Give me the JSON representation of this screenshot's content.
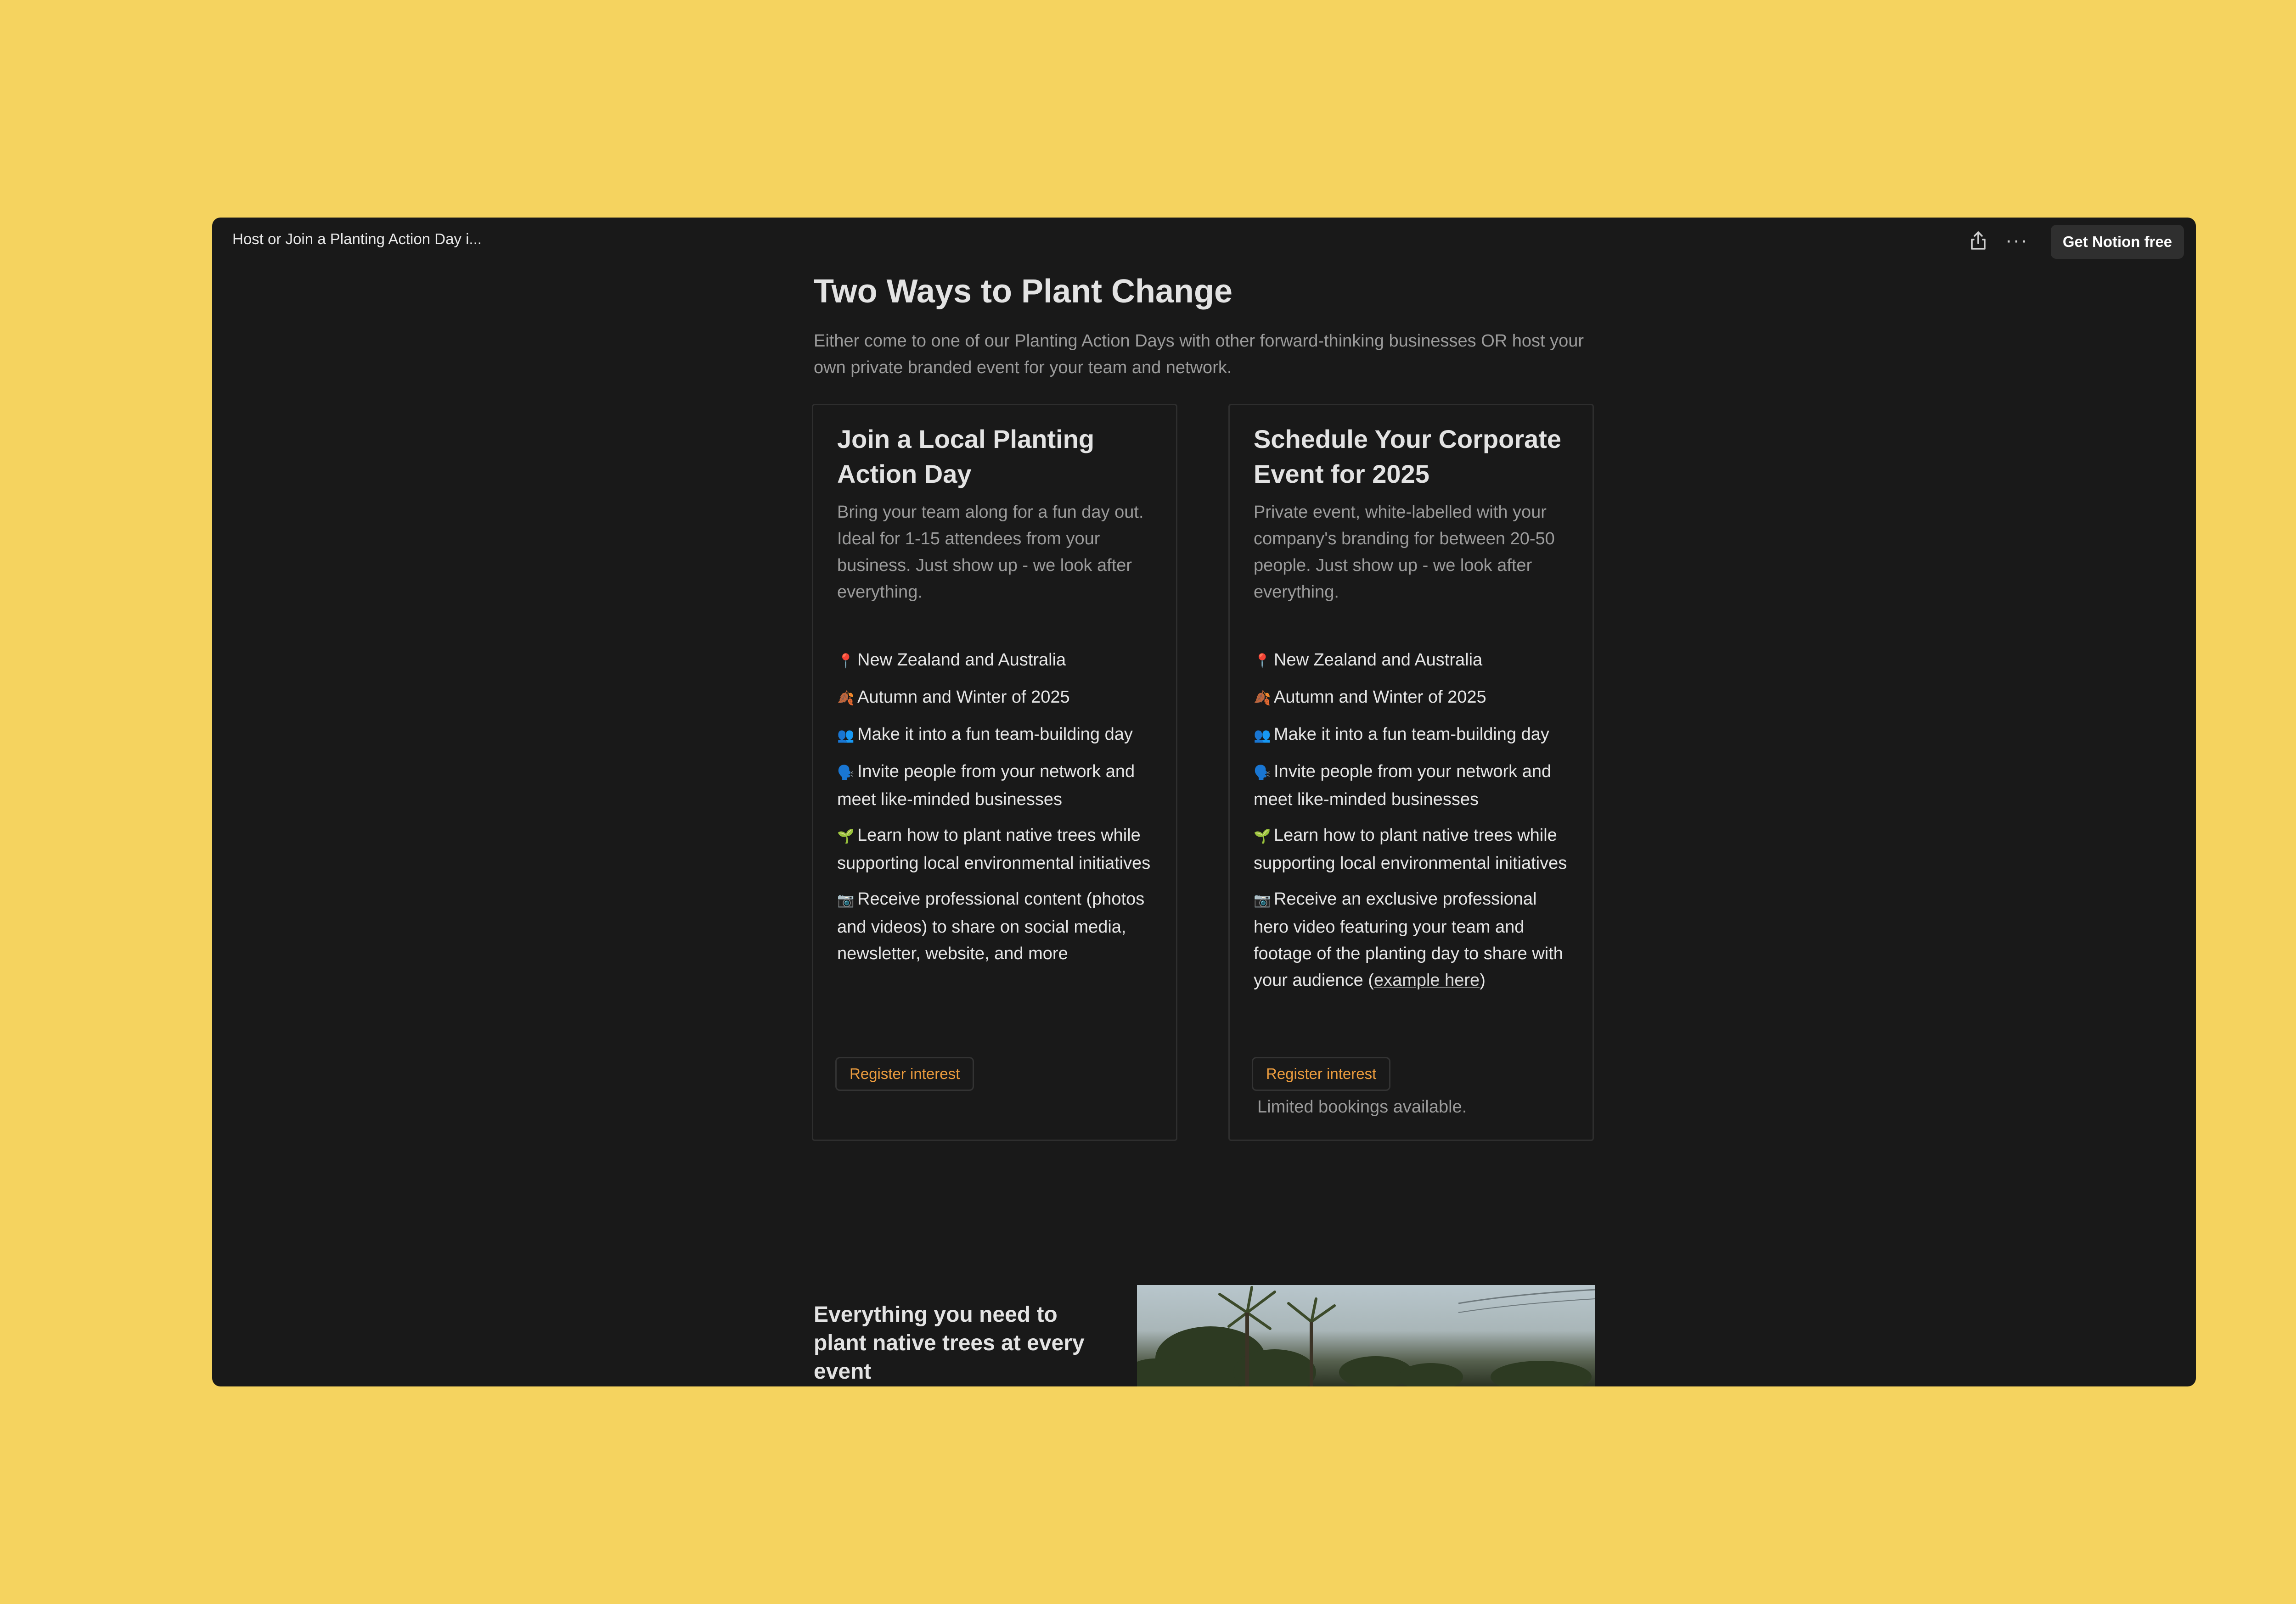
{
  "topbar": {
    "page_tab_title": "Host or Join a Planting Action Day i...",
    "get_notion_label": "Get Notion free",
    "more_label": "···"
  },
  "page": {
    "title": "Two Ways to Plant Change",
    "description": "Either come to one of our Planting Action Days with other forward-thinking businesses OR host your own private branded event for your team and network."
  },
  "cards": [
    {
      "title": "Join a Local Planting Action Day",
      "description": "Bring your team along for a fun day out. Ideal for 1-15 attendees from your business. Just show up - we look after everything.",
      "features": [
        {
          "emoji": "📍",
          "text": "New Zealand and Australia"
        },
        {
          "emoji": "🍂",
          "text": "Autumn and Winter of 2025"
        },
        {
          "emoji": "👥",
          "text": "Make it into a fun team-building day"
        },
        {
          "emoji": "🗣️",
          "text": "Invite people from your network and meet like-minded businesses"
        },
        {
          "emoji": "🌱",
          "text": "Learn how to plant native trees while supporting local environmental initiatives"
        },
        {
          "emoji": "📷",
          "text": "Receive professional content (photos and videos) to share on social media, newsletter, website, and more"
        }
      ],
      "button_label": "Register interest"
    },
    {
      "title": "Schedule Your Corporate Event for 2025",
      "description": "Private event, white-labelled with your company's branding for between 20-50 people. Just show up - we look after everything.",
      "features": [
        {
          "emoji": "📍",
          "text": "New Zealand and Australia"
        },
        {
          "emoji": "🍂",
          "text": "Autumn and Winter of 2025"
        },
        {
          "emoji": "👥",
          "text": "Make it into a fun team-building day"
        },
        {
          "emoji": "🗣️",
          "text": "Invite people from your network and meet like-minded businesses"
        },
        {
          "emoji": "🌱",
          "text": "Learn how to plant native trees while supporting local environmental initiatives"
        },
        {
          "emoji": "📷",
          "text": "Receive an exclusive professional hero video featuring your team and footage of the planting day to share with your audience (",
          "link": "example here",
          "suffix": ")"
        }
      ],
      "button_label": "Register interest",
      "note": "Limited bookings available."
    }
  ],
  "section": {
    "heading": "Everything you need to plant native trees at every event"
  },
  "colors": {
    "background": "#f5d35f",
    "window": "#191919",
    "accent": "#ec9c3e"
  }
}
